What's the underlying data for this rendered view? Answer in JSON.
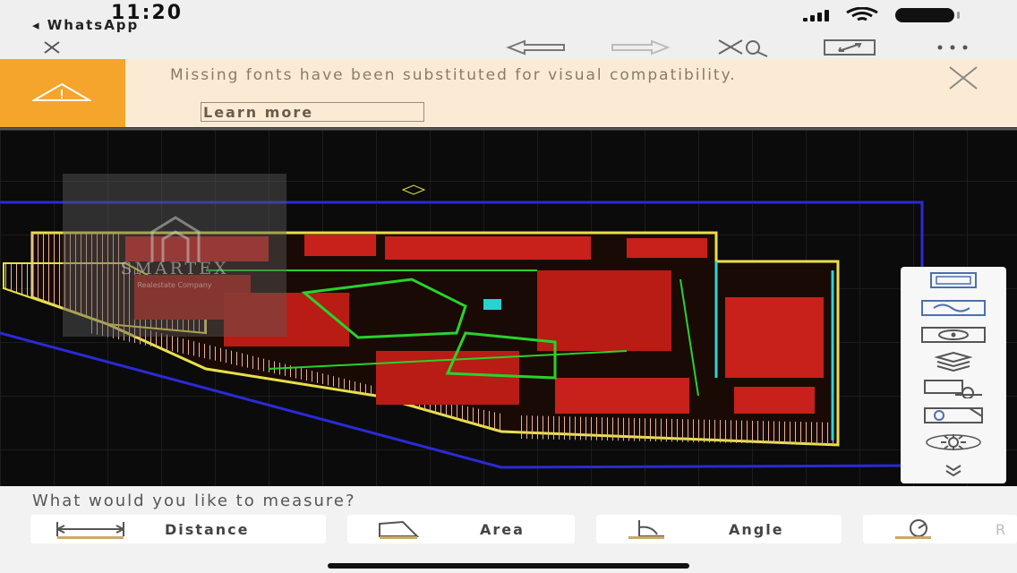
{
  "status": {
    "time": "11:20",
    "back_app": "◂ WhatsApp"
  },
  "toolbar": {
    "icons": [
      "close-icon",
      "undo-icon",
      "redo-icon",
      "measure-tool-icon",
      "fullscreen-icon",
      "more-icon"
    ]
  },
  "banner": {
    "message": "Missing fonts have been substituted for visual compatibility.",
    "learn_more": "Learn more",
    "accent": "#f5a42c",
    "background": "#fcebd4"
  },
  "watermark": {
    "name": "SMARTEX",
    "subtitle": "Realestate Company"
  },
  "side_panel": {
    "icons": [
      "layout-icon",
      "model-icon",
      "view-icon",
      "layers-icon",
      "compare-icon",
      "attach-icon",
      "settings-icon",
      "expand-down-icon"
    ]
  },
  "measure": {
    "question": "What would you like to measure?",
    "options": [
      {
        "label": "Distance",
        "icon": "distance-icon"
      },
      {
        "label": "Area",
        "icon": "area-icon"
      },
      {
        "label": "Angle",
        "icon": "angle-icon"
      },
      {
        "label": "R",
        "icon": "radius-icon"
      }
    ]
  },
  "colors": {
    "canvas": "#0b0b0b",
    "cad_red": "#e0231c",
    "cad_yellow": "#e8e04a",
    "cad_green": "#28d22c",
    "cad_blue": "#2222d8"
  }
}
